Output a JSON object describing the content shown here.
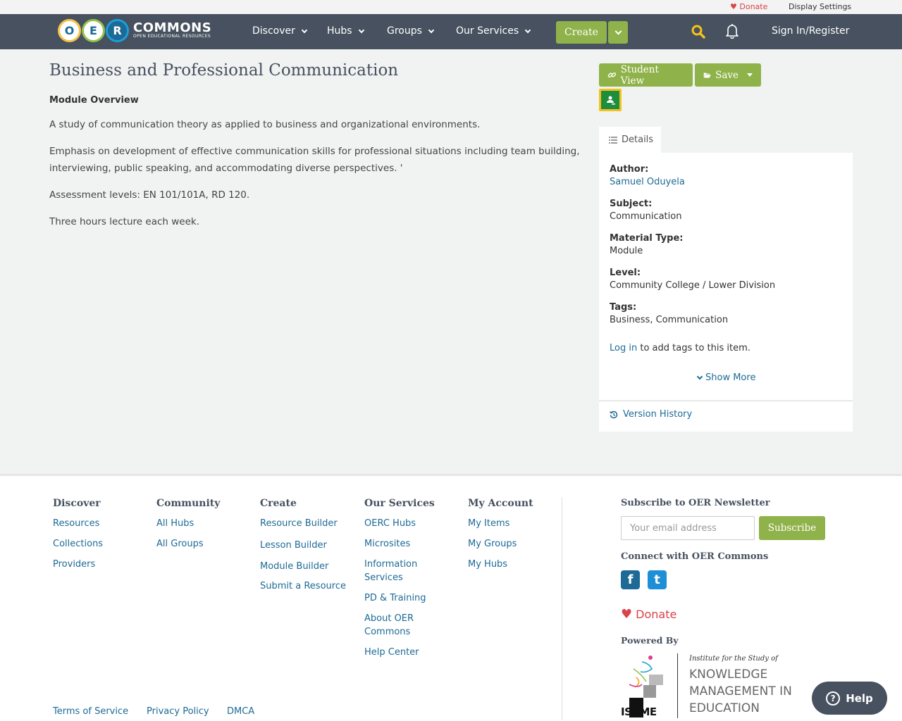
{
  "utility": {
    "donate": "Donate",
    "display_settings": "Display Settings"
  },
  "nav": {
    "logo_o": "O",
    "logo_e": "E",
    "logo_r": "R",
    "logo_title": "COMMONS",
    "logo_subtitle": "OPEN EDUCATIONAL RESOURCES",
    "items": [
      "Discover",
      "Hubs",
      "Groups",
      "Our Services"
    ],
    "create": "Create",
    "signin": "Sign In/Register"
  },
  "page": {
    "title": "Business and Professional Communication",
    "overview_heading": "Module Overview",
    "paragraphs": [
      "A study of communication theory as applied to business and organizational environments.",
      "Emphasis on development of effective communication skills for professional situations including team building, interviewing, public speaking, and accommodating diverse perspectives. '",
      "Assessment levels: EN 101/101A, RD 120.",
      "Three hours lecture each week."
    ]
  },
  "sidebar": {
    "student_view": "Student View",
    "save": "Save",
    "details_tab": "Details",
    "author_label": "Author:",
    "author": "Samuel Oduyela",
    "subject_label": "Subject:",
    "subject": "Communication",
    "material_label": "Material Type:",
    "material": "Module",
    "level_label": "Level:",
    "level": "Community College / Lower Division",
    "tags_label": "Tags:",
    "tags": "Business, Communication",
    "login": "Log in",
    "login_suffix": "to add tags to this item.",
    "show_more": "Show More",
    "version_history": "Version History"
  },
  "footer": {
    "discover": {
      "heading": "Discover",
      "links": [
        "Resources",
        "Collections",
        "Providers"
      ]
    },
    "community": {
      "heading": "Community",
      "links": [
        "All Hubs",
        "All Groups"
      ]
    },
    "create": {
      "heading": "Create",
      "links": [
        "Resource Builder",
        "Lesson Builder",
        "Module Builder",
        "Submit a Resource"
      ]
    },
    "services": {
      "heading": "Our Services",
      "links": [
        "OERC Hubs",
        "Microsites",
        "Information",
        "Services",
        "PD & Training",
        "About OER",
        "Commons",
        "Help Center"
      ]
    },
    "account": {
      "heading": "My Account",
      "links": [
        "My Items",
        "My Groups",
        "My Hubs"
      ]
    },
    "newsletter_heading": "Subscribe to OER Newsletter",
    "email_placeholder": "Your email address",
    "subscribe": "Subscribe",
    "connect_heading": "Connect with OER Commons",
    "facebook_glyph": "f",
    "twitter_glyph": "t",
    "donate": "Donate",
    "powered_by": "Powered By",
    "iskme_tagline": "Institute for the Study of",
    "iskme_line1": "KNOWLEDGE",
    "iskme_line2": "MANAGEMENT IN",
    "iskme_line3": "EDUCATION",
    "iskme_short": "ISKME",
    "legal": [
      "Terms of Service",
      "Privacy Policy",
      "DMCA"
    ]
  },
  "help": {
    "label": "Help",
    "glyph": "?"
  },
  "colors": {
    "nav_bg": "#47515f",
    "green": "#8fb24a",
    "link": "#1d6a96",
    "donate": "#d9434b"
  }
}
